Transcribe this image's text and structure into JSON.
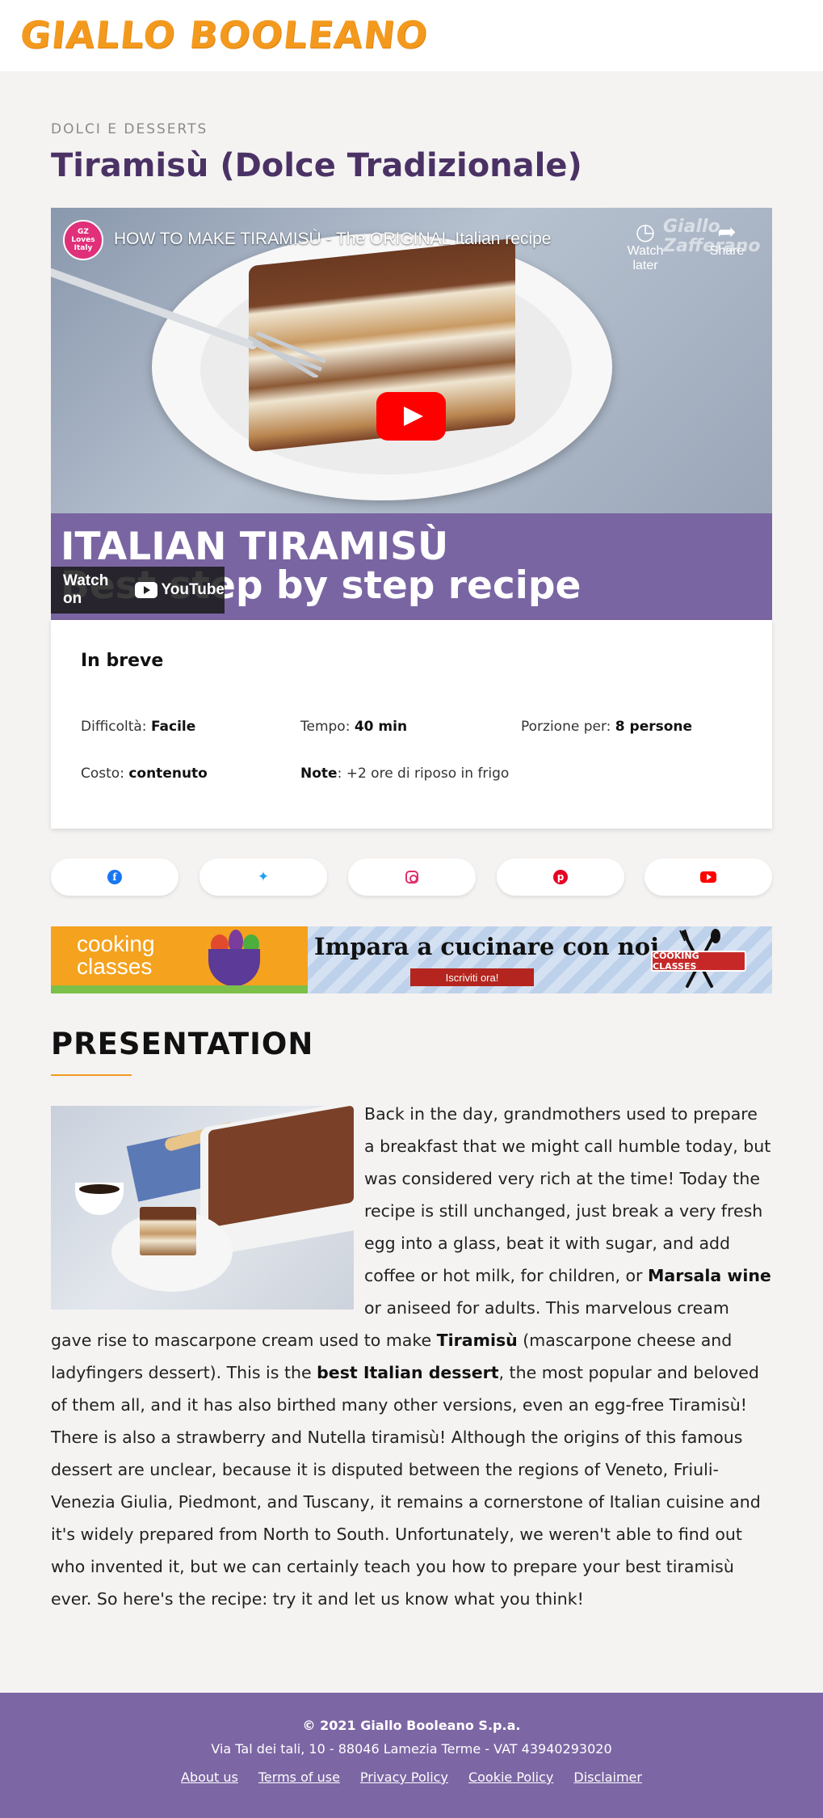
{
  "header": {
    "logo": "GIALLO BOOLEANO"
  },
  "recipe": {
    "category": "DOLCI E DESSERTS",
    "title": "Tiramisù (Dolce Tradizionale)"
  },
  "video": {
    "channel_avatar_text": "GZ Loves Italy",
    "title": "HOW TO MAKE TIRAMISÙ - The ORIGINAL Italian recipe",
    "watermark": "Giallo Zafferano",
    "watch_later": "Watch later",
    "share": "Share",
    "overlay_line1": "ITALIAN TIRAMISÙ",
    "overlay_line2": "Best step by step recipe",
    "watch_on": "Watch on",
    "youtube": "YouTube"
  },
  "summary": {
    "title": "In breve",
    "difficulty_label": "Difficoltà:",
    "difficulty_value": "Facile",
    "time_label": "Tempo:",
    "time_value": "40 min",
    "portions_label": "Porzione per:",
    "portions_value": "8 persone",
    "cost_label": "Costo:",
    "cost_value": "contenuto",
    "note_label": "Note",
    "note_value": ": +2 ore di riposo in frigo"
  },
  "social": [
    {
      "icon": "facebook-icon",
      "color": "#1877f2"
    },
    {
      "icon": "twitter-icon",
      "color": "#1da1f2"
    },
    {
      "icon": "instagram-icon",
      "color": "#e1306c"
    },
    {
      "icon": "pinterest-icon",
      "color": "#e60023"
    },
    {
      "icon": "youtube-icon",
      "color": "#ff0000"
    }
  ],
  "banner": {
    "left_line1": "cooking",
    "left_line2": "classes",
    "headline": "Impara a cucinare con noi",
    "cta": "Iscriviti ora!",
    "badge": "COOKING CLASSES"
  },
  "presentation": {
    "title": "PRESENTATION",
    "p1": "Back in the day, grandmothers used to prepare a breakfast that we might call humble today, but was considered very rich at the time! Today the recipe is still unchanged, just break a very fresh egg into a glass, beat it with sugar, and add coffee or hot milk, for children, or ",
    "b1": "Marsala wine",
    "p2": " or aniseed for adults. This marvelous cream gave rise to mascarpone cream used to make ",
    "b2": "Tiramisù",
    "p3": " (mascarpone cheese and ladyfingers dessert). This is the ",
    "b3": "best Italian dessert",
    "p4": ", the most popular and beloved of them all, and it has also birthed many other versions, even an egg-free Tiramisù! There is also a strawberry and Nutella tiramisù! Although the origins of this famous dessert are unclear, because it is disputed between the regions of Veneto, Friuli-Venezia Giulia, Piedmont, and Tuscany, it remains a cornerstone of Italian cuisine and it's widely prepared from North to South. Unfortunately, we weren't able to find out who invented it, but we can certainly teach you how to prepare your best tiramisù ever. So here's the recipe: try it and let us know what you think!"
  },
  "footer": {
    "copyright": "© 2021 Giallo Booleano S.p.a.",
    "address": "Via Tal dei tali, 10 - 88046 Lamezia Terme - VAT 43940293020",
    "links": [
      "About us",
      "Terms of use",
      "Privacy Policy",
      "Cookie Policy",
      "Disclaimer"
    ]
  },
  "colors": {
    "brand_orange": "#f39a1e",
    "brand_purple": "#7c66a4",
    "title_purple": "#4a3265"
  }
}
